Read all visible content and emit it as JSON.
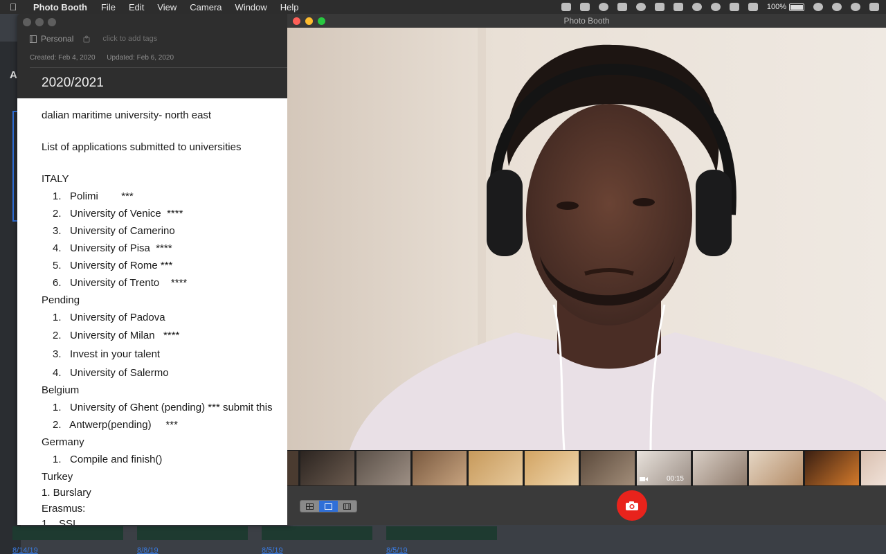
{
  "menubar": {
    "app_name": "Photo Booth",
    "items": [
      "File",
      "Edit",
      "View",
      "Camera",
      "Window",
      "Help"
    ],
    "battery": "100%"
  },
  "background_app": {
    "label": "A",
    "dates": [
      "8/14/19",
      "8/8/19",
      "8/5/19",
      "8/5/19"
    ]
  },
  "notes": {
    "notebook": "Personal",
    "tags_placeholder": "click to add tags",
    "created": "Created: Feb 4, 2020",
    "updated": "Updated: Feb 6, 2020",
    "title": "2020/2021",
    "lines": [
      "dalian maritime university- north east",
      "List of applications submitted to universities",
      "ITALY",
      "1.   Polimi        ***",
      "2.   University of Venice  ****",
      "3.   University of Camerino",
      "4.   University of Pisa  ****",
      "5.   University of Rome ***",
      "6.   University of Trento    ****",
      "Pending",
      "1.   University of Padova",
      "2.   University of Milan   ****",
      "3.   Invest in your talent",
      "4.   University of Salermo",
      "Belgium",
      "1.   University of Ghent (pending) *** submit this",
      "2.   Antwerp(pending)     ***",
      "Germany",
      "1.   Compile and finish()",
      "Turkey",
      "1. Burslary",
      "Erasmus:",
      "1.   SSI"
    ]
  },
  "photobooth": {
    "title": "Photo Booth",
    "thumb_video_time": "00:15",
    "shutter_color": "#e8231c",
    "selected_mode": "single-photo"
  }
}
